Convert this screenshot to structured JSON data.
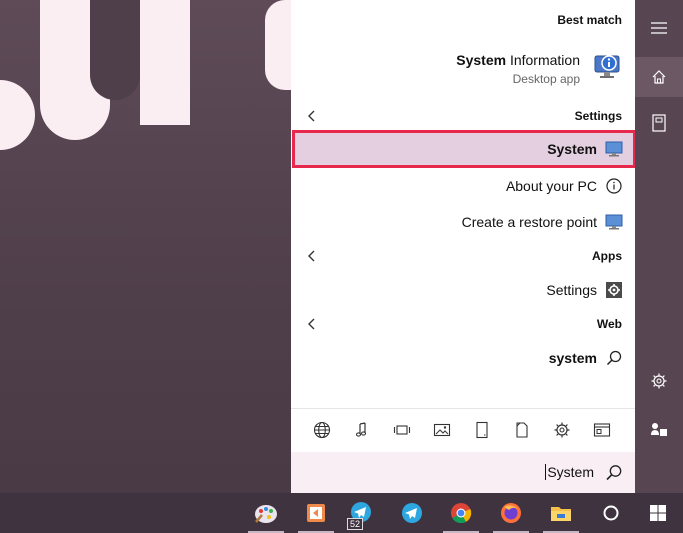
{
  "best_match": {
    "header": "Best match",
    "title_bold": "System",
    "title_rest": " Information",
    "subtitle": "Desktop app"
  },
  "settings_section": {
    "header": "Settings"
  },
  "settings_items": [
    {
      "label": "System"
    },
    {
      "label": "About your PC"
    },
    {
      "label": "Create a restore point"
    }
  ],
  "apps_section": {
    "header": "Apps"
  },
  "apps_items": [
    {
      "label": "Settings"
    }
  ],
  "web_section": {
    "header": "Web"
  },
  "web_items": [
    {
      "label": "system"
    }
  ],
  "search": {
    "value": "System"
  },
  "taskbar": {
    "badge": "52"
  },
  "colors": {
    "selection_border": "#e8294e",
    "selection_bg": "#e4cfe0",
    "rail_bg": "#574551",
    "taskbar_bg": "#3f3340"
  }
}
